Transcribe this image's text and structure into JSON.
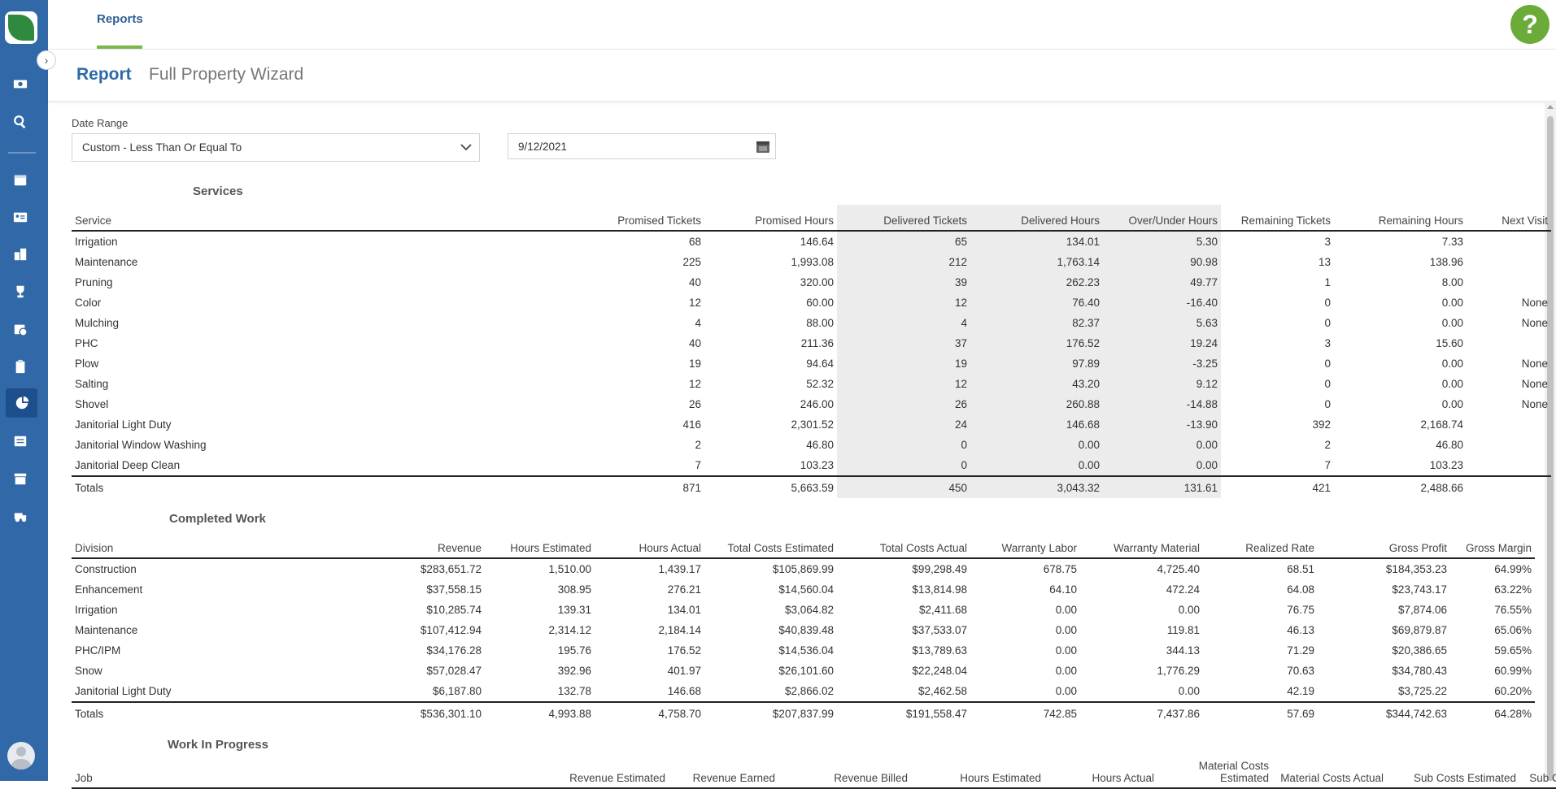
{
  "topbar": {
    "tab": "Reports",
    "help": "?"
  },
  "header": {
    "title": "Report",
    "subtitle": "Full Property Wizard"
  },
  "filters": {
    "date_range_label": "Date Range",
    "date_range_value": "Custom - Less Than Or Equal To",
    "date_value": "9/12/2021"
  },
  "services": {
    "title": "Services",
    "columns": [
      "Service",
      "Promised Tickets",
      "Promised Hours",
      "Delivered Tickets",
      "Delivered Hours",
      "Over/Under Hours",
      "Remaining Tickets",
      "Remaining Hours",
      "Next Visit"
    ],
    "rows": [
      [
        "Irrigation",
        "68",
        "146.64",
        "65",
        "134.01",
        "5.30",
        "3",
        "7.33",
        ""
      ],
      [
        "Maintenance",
        "225",
        "1,993.08",
        "212",
        "1,763.14",
        "90.98",
        "13",
        "138.96",
        ""
      ],
      [
        "Pruning",
        "40",
        "320.00",
        "39",
        "262.23",
        "49.77",
        "1",
        "8.00",
        ""
      ],
      [
        "Color",
        "12",
        "60.00",
        "12",
        "76.40",
        "-16.40",
        "0",
        "0.00",
        "None"
      ],
      [
        "Mulching",
        "4",
        "88.00",
        "4",
        "82.37",
        "5.63",
        "0",
        "0.00",
        "None"
      ],
      [
        "PHC",
        "40",
        "211.36",
        "37",
        "176.52",
        "19.24",
        "3",
        "15.60",
        ""
      ],
      [
        "Plow",
        "19",
        "94.64",
        "19",
        "97.89",
        "-3.25",
        "0",
        "0.00",
        "None"
      ],
      [
        "Salting",
        "12",
        "52.32",
        "12",
        "43.20",
        "9.12",
        "0",
        "0.00",
        "None"
      ],
      [
        "Shovel",
        "26",
        "246.00",
        "26",
        "260.88",
        "-14.88",
        "0",
        "0.00",
        "None"
      ],
      [
        "Janitorial Light Duty",
        "416",
        "2,301.52",
        "24",
        "146.68",
        "-13.90",
        "392",
        "2,168.74",
        ""
      ],
      [
        "Janitorial Window Washing",
        "2",
        "46.80",
        "0",
        "0.00",
        "0.00",
        "2",
        "46.80",
        ""
      ],
      [
        "Janitorial Deep Clean",
        "7",
        "103.23",
        "0",
        "0.00",
        "0.00",
        "7",
        "103.23",
        ""
      ]
    ],
    "totals": [
      "Totals",
      "871",
      "5,663.59",
      "450",
      "3,043.32",
      "131.61",
      "421",
      "2,488.66",
      ""
    ]
  },
  "completed": {
    "title": "Completed Work",
    "columns": [
      "Division",
      "Revenue",
      "Hours Estimated",
      "Hours Actual",
      "Total Costs Estimated",
      "Total Costs Actual",
      "Warranty Labor",
      "Warranty Material",
      "Realized Rate",
      "Gross Profit",
      "Gross Margin"
    ],
    "rows": [
      [
        "Construction",
        "$283,651.72",
        "1,510.00",
        "1,439.17",
        "$105,869.99",
        "$99,298.49",
        "678.75",
        "4,725.40",
        "68.51",
        "$184,353.23",
        "64.99%"
      ],
      [
        "Enhancement",
        "$37,558.15",
        "308.95",
        "276.21",
        "$14,560.04",
        "$13,814.98",
        "64.10",
        "472.24",
        "64.08",
        "$23,743.17",
        "63.22%"
      ],
      [
        "Irrigation",
        "$10,285.74",
        "139.31",
        "134.01",
        "$3,064.82",
        "$2,411.68",
        "0.00",
        "0.00",
        "76.75",
        "$7,874.06",
        "76.55%"
      ],
      [
        "Maintenance",
        "$107,412.94",
        "2,314.12",
        "2,184.14",
        "$40,839.48",
        "$37,533.07",
        "0.00",
        "119.81",
        "46.13",
        "$69,879.87",
        "65.06%"
      ],
      [
        "PHC/IPM",
        "$34,176.28",
        "195.76",
        "176.52",
        "$14,536.04",
        "$13,789.63",
        "0.00",
        "344.13",
        "71.29",
        "$20,386.65",
        "59.65%"
      ],
      [
        "Snow",
        "$57,028.47",
        "392.96",
        "401.97",
        "$26,101.60",
        "$22,248.04",
        "0.00",
        "1,776.29",
        "70.63",
        "$34,780.43",
        "60.99%"
      ],
      [
        "Janitorial Light Duty",
        "$6,187.80",
        "132.78",
        "146.68",
        "$2,866.02",
        "$2,462.58",
        "0.00",
        "0.00",
        "42.19",
        "$3,725.22",
        "60.20%"
      ]
    ],
    "totals": [
      "Totals",
      "$536,301.10",
      "4,993.88",
      "4,758.70",
      "$207,837.99",
      "$191,558.47",
      "742.85",
      "7,437.86",
      "57.69",
      "$344,742.63",
      "64.28%"
    ]
  },
  "wip": {
    "title": "Work In Progress",
    "columns": [
      "Job",
      "Revenue Estimated",
      "Revenue Earned",
      "Revenue Billed",
      "Hours Estimated",
      "Hours Actual",
      "Material Costs Estimated",
      "Material Costs Actual",
      "Sub Costs Estimated",
      "Sub Costs Actual"
    ]
  },
  "sidebar_icons": [
    "money-icon",
    "search-icon",
    "calendar-icon",
    "contacts-icon",
    "buildings-icon",
    "trophy-icon",
    "schedule-icon",
    "clipboard-icon",
    "reports-icon",
    "invoice-icon",
    "archive-icon",
    "equipment-icon"
  ]
}
